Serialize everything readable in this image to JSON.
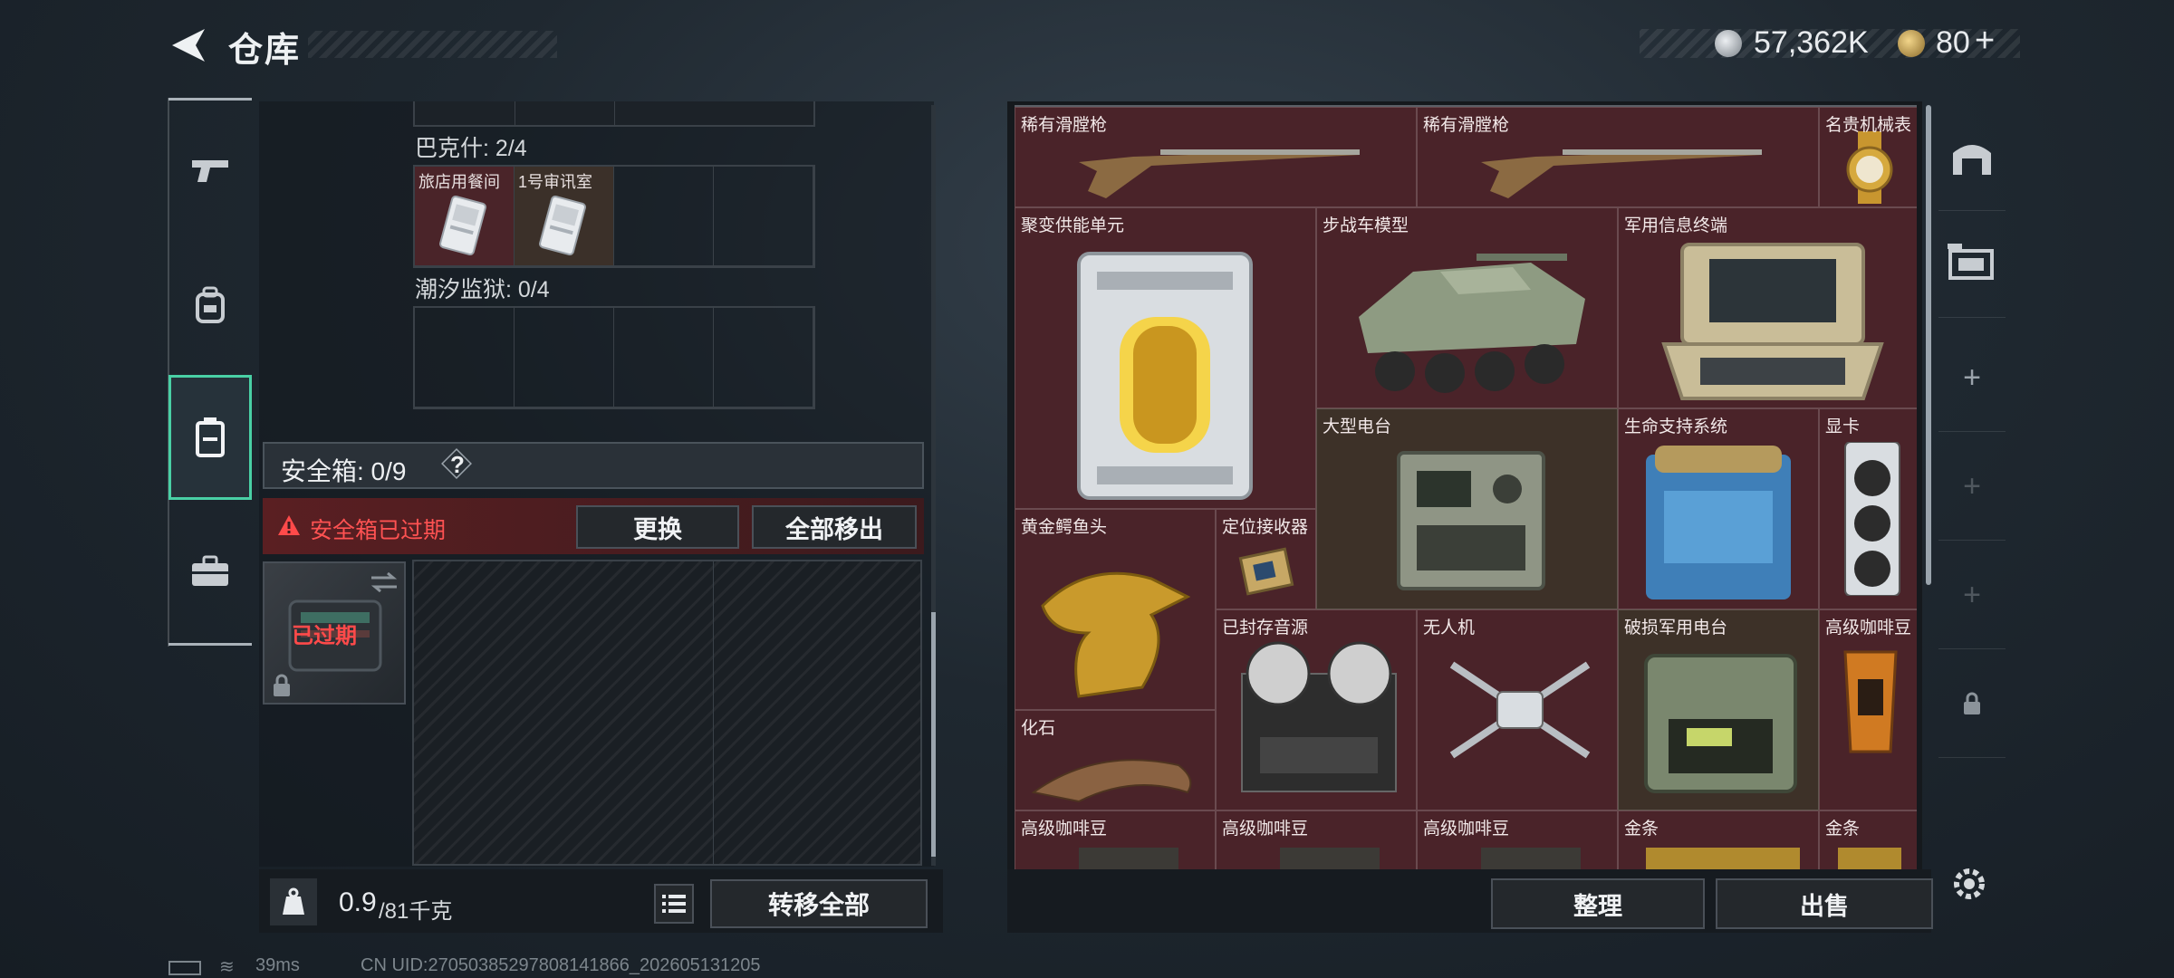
{
  "header": {
    "title": "仓库"
  },
  "currency": [
    {
      "icon": "silver-coin-icon",
      "value": "57,362K",
      "color": "#c9ced3"
    },
    {
      "icon": "gold-coin-icon",
      "value": "80",
      "suffix": "+",
      "color": "#d8b25e"
    }
  ],
  "left_nav": [
    {
      "icon": "gun-icon",
      "active": false
    },
    {
      "icon": "backpack-icon",
      "active": false
    },
    {
      "icon": "safe-case-icon",
      "active": true
    },
    {
      "icon": "briefcase-icon",
      "active": false
    }
  ],
  "keys": {
    "bakeshi": {
      "label": "巴克什: 2/4",
      "items": [
        "旅店用餐间",
        "1号审讯室"
      ]
    },
    "chaoxi": {
      "label": "潮汐监狱: 0/4"
    }
  },
  "safebox": {
    "label": "安全箱: 0/9",
    "help": "?",
    "expired_notice": "安全箱已过期",
    "replace_button": "更换",
    "move_all_out_button": "全部移出",
    "case_status": "已过期"
  },
  "weight": {
    "current": "0.9",
    "max": "/81千克"
  },
  "transfer_all_button": "转移全部",
  "vault_items": [
    {
      "name": "稀有滑膛枪",
      "kind": "musket"
    },
    {
      "name": "稀有滑膛枪",
      "kind": "musket"
    },
    {
      "name": "名贵机械表",
      "kind": "watch"
    },
    {
      "name": "聚变供能单元",
      "kind": "reactor"
    },
    {
      "name": "步战车模型",
      "kind": "ifv"
    },
    {
      "name": "军用信息终端",
      "kind": "terminal"
    },
    {
      "name": "大型电台",
      "kind": "radio"
    },
    {
      "name": "生命支持系统",
      "kind": "lifesupport"
    },
    {
      "name": "显卡",
      "kind": "gpu"
    },
    {
      "name": "黄金鳄鱼头",
      "kind": "croc"
    },
    {
      "name": "定位接收器",
      "kind": "receiver"
    },
    {
      "name": "已封存音源",
      "kind": "reel"
    },
    {
      "name": "无人机",
      "kind": "drone"
    },
    {
      "name": "破损军用电台",
      "kind": "brokenradio"
    },
    {
      "name": "高级咖啡豆",
      "kind": "coffee"
    },
    {
      "name": "化石",
      "kind": "fossil"
    },
    {
      "name": "高级咖啡豆",
      "kind": "coffee"
    },
    {
      "name": "高级咖啡豆",
      "kind": "coffee"
    },
    {
      "name": "高级咖啡豆",
      "kind": "coffee"
    },
    {
      "name": "金条",
      "kind": "goldbar"
    },
    {
      "name": "金条",
      "kind": "goldbar"
    }
  ],
  "actions": {
    "sort_button": "整理",
    "sell_button": "出售"
  },
  "status_bar": {
    "ping": "39ms",
    "uid": "CN UID:270503852978081418​66_202605131205"
  }
}
